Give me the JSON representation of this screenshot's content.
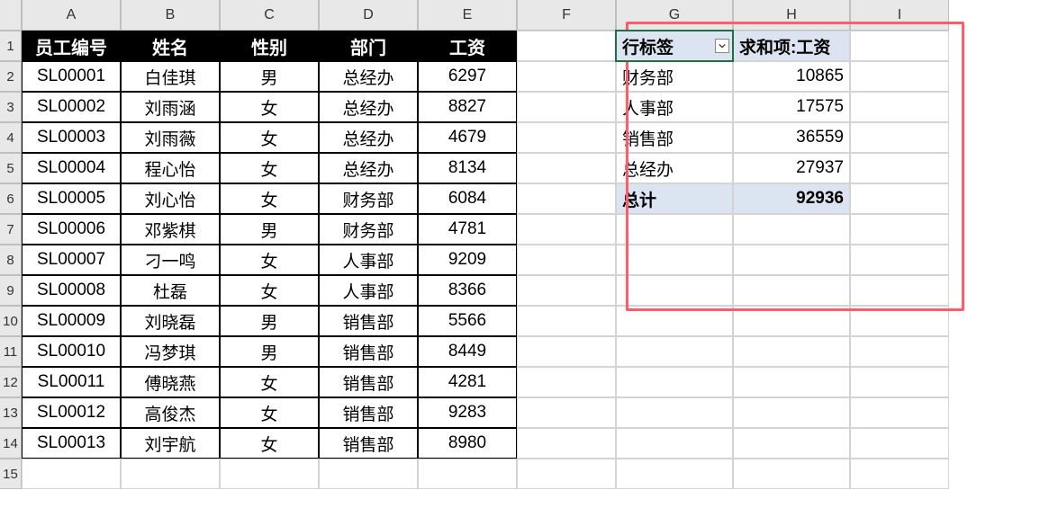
{
  "columns": [
    "A",
    "B",
    "C",
    "D",
    "E",
    "F",
    "G",
    "H",
    "I"
  ],
  "rowCount": 15,
  "table": {
    "headers": [
      "员工编号",
      "姓名",
      "性别",
      "部门",
      "工资"
    ],
    "rows": [
      {
        "id": "SL00001",
        "name": "白佳琪",
        "gender": "男",
        "dept": "总经办",
        "salary": "6297"
      },
      {
        "id": "SL00002",
        "name": "刘雨涵",
        "gender": "女",
        "dept": "总经办",
        "salary": "8827"
      },
      {
        "id": "SL00003",
        "name": "刘雨薇",
        "gender": "女",
        "dept": "总经办",
        "salary": "4679"
      },
      {
        "id": "SL00004",
        "name": "程心怡",
        "gender": "女",
        "dept": "总经办",
        "salary": "8134"
      },
      {
        "id": "SL00005",
        "name": "刘心怡",
        "gender": "女",
        "dept": "财务部",
        "salary": "6084"
      },
      {
        "id": "SL00006",
        "name": "邓紫棋",
        "gender": "男",
        "dept": "财务部",
        "salary": "4781"
      },
      {
        "id": "SL00007",
        "name": "刁一鸣",
        "gender": "女",
        "dept": "人事部",
        "salary": "9209"
      },
      {
        "id": "SL00008",
        "name": "杜磊",
        "gender": "女",
        "dept": "人事部",
        "salary": "8366"
      },
      {
        "id": "SL00009",
        "name": "刘晓磊",
        "gender": "男",
        "dept": "销售部",
        "salary": "5566"
      },
      {
        "id": "SL00010",
        "name": "冯梦琪",
        "gender": "男",
        "dept": "销售部",
        "salary": "8449"
      },
      {
        "id": "SL00011",
        "name": "傅晓燕",
        "gender": "女",
        "dept": "销售部",
        "salary": "4281"
      },
      {
        "id": "SL00012",
        "name": "高俊杰",
        "gender": "女",
        "dept": "销售部",
        "salary": "9283"
      },
      {
        "id": "SL00013",
        "name": "刘宇航",
        "gender": "女",
        "dept": "销售部",
        "salary": "8980"
      }
    ]
  },
  "pivot": {
    "rowLabel": "行标签",
    "valueLabel": "求和项:工资",
    "rows": [
      {
        "label": "财务部",
        "value": "10865"
      },
      {
        "label": "人事部",
        "value": "17575"
      },
      {
        "label": "销售部",
        "value": "36559"
      },
      {
        "label": "总经办",
        "value": "27937"
      }
    ],
    "totalLabel": "总计",
    "totalValue": "92936"
  }
}
